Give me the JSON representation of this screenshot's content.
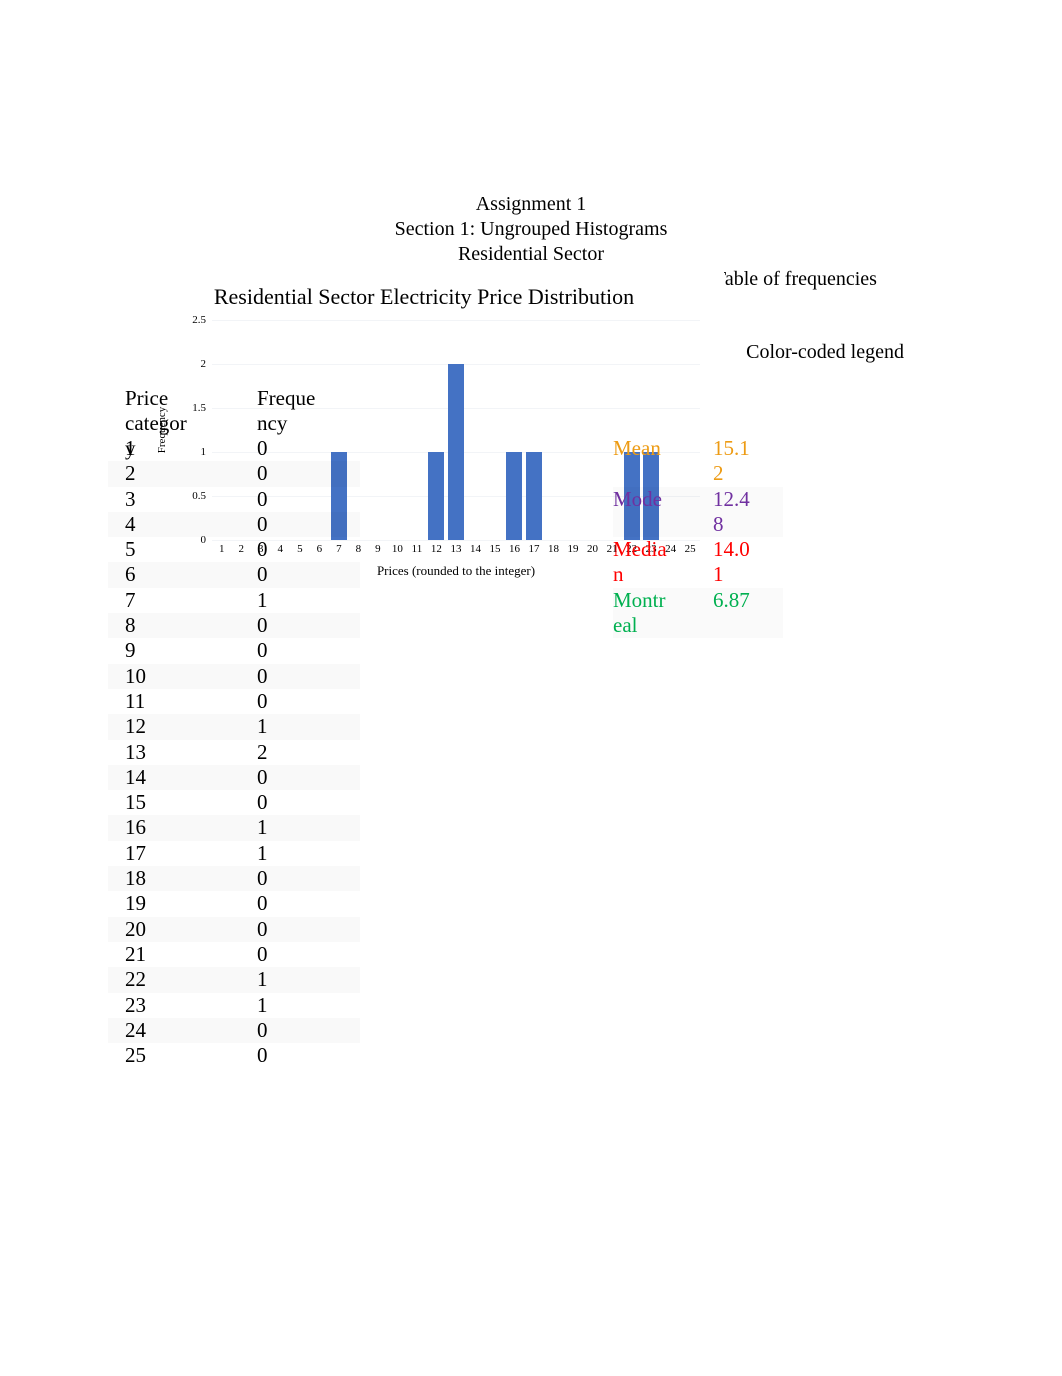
{
  "page_heading": {
    "line1": "Assignment 1",
    "line2": "Section 1: Ungrouped Histograms",
    "line3": "Residential Sector"
  },
  "annotations": {
    "table_of_frequencies": "Table of frequencies",
    "color_coded_legend": "Color-coded legend"
  },
  "freq_table": {
    "header_category": "Price category",
    "header_frequency": "Frequency",
    "rows": [
      {
        "category": "1",
        "frequency": "0"
      },
      {
        "category": "2",
        "frequency": "0"
      },
      {
        "category": "3",
        "frequency": "0"
      },
      {
        "category": "4",
        "frequency": "0"
      },
      {
        "category": "5",
        "frequency": "0"
      },
      {
        "category": "6",
        "frequency": "0"
      },
      {
        "category": "7",
        "frequency": "1"
      },
      {
        "category": "8",
        "frequency": "0"
      },
      {
        "category": "9",
        "frequency": "0"
      },
      {
        "category": "10",
        "frequency": "0"
      },
      {
        "category": "11",
        "frequency": "0"
      },
      {
        "category": "12",
        "frequency": "1"
      },
      {
        "category": "13",
        "frequency": "2"
      },
      {
        "category": "14",
        "frequency": "0"
      },
      {
        "category": "15",
        "frequency": "0"
      },
      {
        "category": "16",
        "frequency": "1"
      },
      {
        "category": "17",
        "frequency": "1"
      },
      {
        "category": "18",
        "frequency": "0"
      },
      {
        "category": "19",
        "frequency": "0"
      },
      {
        "category": "20",
        "frequency": "0"
      },
      {
        "category": "21",
        "frequency": "0"
      },
      {
        "category": "22",
        "frequency": "1"
      },
      {
        "category": "23",
        "frequency": "1"
      },
      {
        "category": "24",
        "frequency": "0"
      },
      {
        "category": "25",
        "frequency": "0"
      }
    ]
  },
  "legend": {
    "rows": [
      {
        "label": "Mean",
        "value": "15.12",
        "color": "#ed9b14"
      },
      {
        "label": "Mode",
        "value": "12.48",
        "color": "#7030a0"
      },
      {
        "label": "Median",
        "value": "14.01",
        "color": "#ff0000"
      },
      {
        "label": "Montreal",
        "value": "6.87",
        "color": "#00b050"
      }
    ]
  },
  "chart_data": {
    "type": "bar",
    "title": "Residential Sector Electricity Price Distribution",
    "xlabel": "Prices (rounded to the integer)",
    "ylabel": "Frequency",
    "categories": [
      "1",
      "2",
      "3",
      "4",
      "5",
      "6",
      "7",
      "8",
      "9",
      "10",
      "11",
      "12",
      "13",
      "14",
      "15",
      "16",
      "17",
      "18",
      "19",
      "20",
      "21",
      "22",
      "23",
      "24",
      "25"
    ],
    "values": [
      0,
      0,
      0,
      0,
      0,
      0,
      1,
      0,
      0,
      0,
      0,
      1,
      2,
      0,
      0,
      1,
      1,
      0,
      0,
      0,
      0,
      1,
      1,
      0,
      0
    ],
    "ylim": [
      0,
      2.5
    ],
    "yticks": [
      "0",
      "0.5",
      "1",
      "1.5",
      "2",
      "2.5"
    ],
    "grid": true,
    "legend_position": "none",
    "bar_color": "#4472c4"
  }
}
